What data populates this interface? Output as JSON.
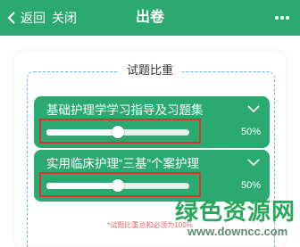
{
  "topbar": {
    "back_label": "返回",
    "close_label": "关闭",
    "title": "出卷",
    "more_icon": "more-dots-icon",
    "back_icon": "chevron-left-icon"
  },
  "section": {
    "title": "试题比重"
  },
  "cards": [
    {
      "title": "基础护理学学习指导及习题集",
      "percent_label": "50%",
      "value": 0.5
    },
    {
      "title": "实用临床护理“三基”个案护理",
      "percent_label": "50%",
      "value": 0.5
    }
  ],
  "note": "*试题比重总和必须为100%",
  "watermark": {
    "text": "绿色资源网",
    "url": "www.downcc.com"
  },
  "colors": {
    "primary": "#2aa971",
    "highlight": "#d9352b",
    "note": "#e06a6a"
  }
}
